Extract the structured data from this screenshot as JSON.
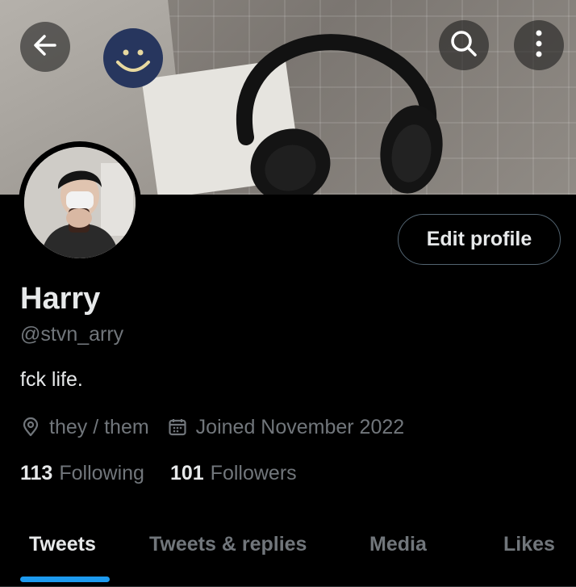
{
  "profile": {
    "name": "Harry",
    "handle": "@stvn_arry",
    "bio": "fck life.",
    "location": "they / them",
    "joined": "Joined November 2022"
  },
  "stats": {
    "following_count": "113",
    "following_label": "Following",
    "followers_count": "101",
    "followers_label": "Followers"
  },
  "actions": {
    "edit_profile_label": "Edit profile"
  },
  "header_icons": [
    "back-arrow-icon",
    "search-icon",
    "more-vertical-icon"
  ],
  "meta_icons": [
    "location-pin-icon",
    "calendar-icon"
  ],
  "tabs": [
    {
      "label": "Tweets",
      "active": true
    },
    {
      "label": "Tweets & replies",
      "active": false
    },
    {
      "label": "Media",
      "active": false
    },
    {
      "label": "Likes",
      "active": false
    }
  ],
  "colors": {
    "background": "#000000",
    "primary_text": "#e7e9ea",
    "secondary_text": "#71767b",
    "accent": "#1d9bf0",
    "button_border": "#536471"
  }
}
